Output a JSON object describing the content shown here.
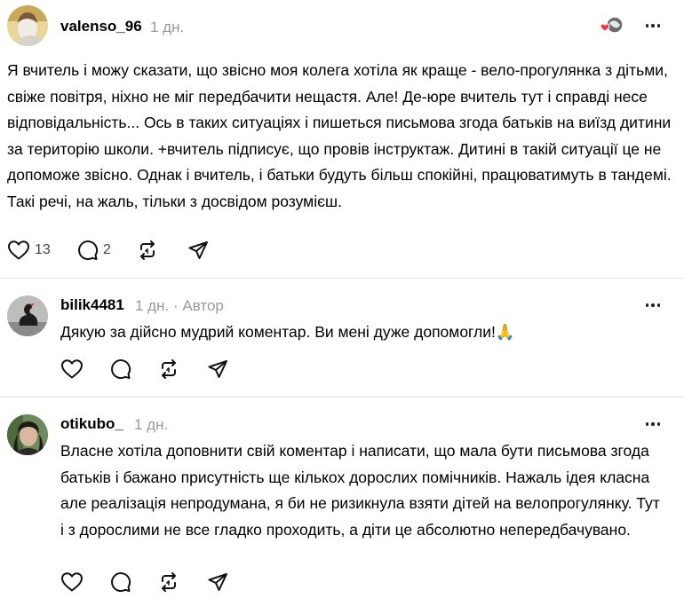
{
  "posts": [
    {
      "username": "valenso_96",
      "time": "1 дн.",
      "text": "Я вчитель і можу сказати, що звісно моя колега хотіла як краще - вело-прогулянка з дітьми, свіже повітря, ніхно не міг передбачити нещастя. Але! Де-юре вчитель тут і справді несе відповідальність... Ось в таких ситуаціях і пишеться письмова згода батьків на виїзд дитини за територію школи. +вчитель підписує, що провів інструктаж. Дитині в такій ситуації це не допоможе звісно. Однак і вчитель, і батьки будуть більш спокійні, працюватимуть в тандемі. Такі речі, на жаль, тільки з досвідом розумієш.",
      "likes": "13",
      "replies": "2"
    },
    {
      "username": "bilik4481",
      "time": "1 дн.",
      "separator": "·",
      "badge": "Автор",
      "text": "Дякую за дійсно мудрий коментар. Ви мені дуже допомогли!",
      "emoji": "🙏"
    },
    {
      "username": "otikubo_",
      "time": "1 дн.",
      "text": "Власне хотіла доповнити свій коментар і написати, що мала бути письмова згода батьків і бажано присутність ще кількох дорослих помічників. Нажаль ідея класна але реалізація непродумана, я би не ризикнула взяти дітей на велопрогулянку. Тут і з дорослими не все гладко проходить, а діти це абсолютно непередбачувано."
    }
  ],
  "colors": {
    "meta": "#9a9a9a",
    "like_red": "#ff3040",
    "divider": "#e2e2e2"
  },
  "icons": [
    "heart-icon",
    "comment-icon",
    "repost-icon",
    "share-icon",
    "more-icon",
    "liked-by-author-icon"
  ]
}
